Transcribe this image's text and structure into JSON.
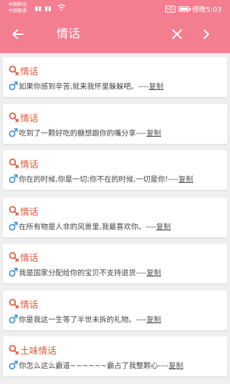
{
  "status_bar": {
    "carrier_1": "中国移动",
    "carrier_2": "中国联通",
    "hd": "HD",
    "time": "傍晚5:03"
  },
  "app_bar": {
    "title": "情话"
  },
  "cards": [
    {
      "title": "情话",
      "text": "如果你感到辛苦,就来我怀里躲躲吧。----",
      "copy": "复制"
    },
    {
      "title": "情话",
      "text": "吃到了一颗好吃的糖想跟你的嘴分享----",
      "copy": "复制"
    },
    {
      "title": "情话",
      "text": "你在的时候,你是一切;你不在的时候,一切是你!----",
      "copy": "复制"
    },
    {
      "title": "情话",
      "text": "在所有物是人非的风景里,我最喜欢你。----",
      "copy": "复制"
    },
    {
      "title": "情话",
      "text": "我是国家分配给你的宝贝不支持退货----",
      "copy": "复制"
    },
    {
      "title": "情话",
      "text": "你是我这一生等了半世未拆的礼物。----",
      "copy": "复制"
    },
    {
      "title": "土味情话",
      "text": "你怎么这么霸道~~~~~~霸占了我整颗心----",
      "copy": "复制"
    }
  ],
  "colors": {
    "header": "#f37e8f",
    "title_accent": "#e05a3c",
    "male_icon": "#3b8fd9"
  }
}
